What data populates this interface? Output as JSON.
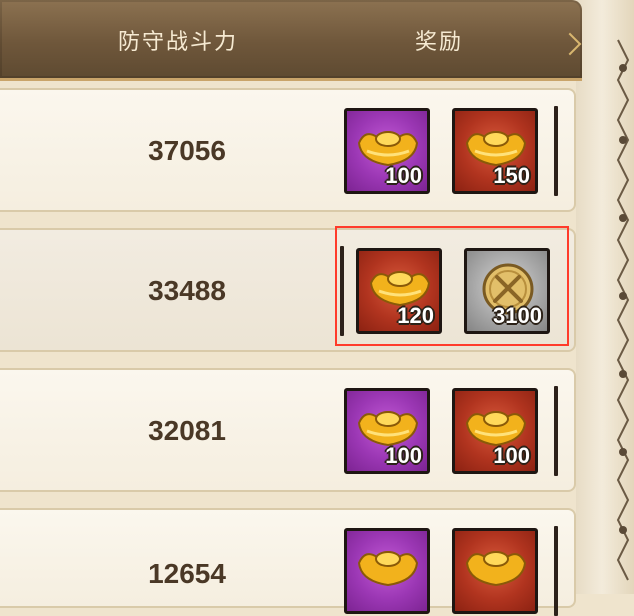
{
  "header": {
    "power_label": "防守战斗力",
    "reward_label": "奖励"
  },
  "rows": [
    {
      "power": "37056",
      "rewards": [
        {
          "icon": "gold-ingot-icon",
          "rarity_color": "#9b37b4",
          "qty": "100"
        },
        {
          "icon": "gold-ingot-icon",
          "rarity_color": "#b1341f",
          "qty": "150"
        }
      ]
    },
    {
      "power": "33488",
      "rewards": [
        {
          "icon": "gold-ingot-icon",
          "rarity_color": "#b1341f",
          "qty": "120"
        },
        {
          "icon": "crossed-swords-coin-icon",
          "rarity_color": "#a9a9a9",
          "qty": "3100"
        }
      ],
      "highlighted": true
    },
    {
      "power": "32081",
      "rewards": [
        {
          "icon": "gold-ingot-icon",
          "rarity_color": "#9b37b4",
          "qty": "100"
        },
        {
          "icon": "gold-ingot-icon",
          "rarity_color": "#b1341f",
          "qty": "100"
        }
      ]
    },
    {
      "power": "12654",
      "rewards": [
        {
          "icon": "gold-ingot-icon",
          "rarity_color": "#9b37b4",
          "qty": ""
        },
        {
          "icon": "gold-ingot-icon",
          "rarity_color": "#b1341f",
          "qty": ""
        }
      ]
    }
  ],
  "colors": {
    "highlight": "#ff3b2b",
    "header_bg": "#6f573b",
    "row_bg": "#fbf7ee"
  }
}
